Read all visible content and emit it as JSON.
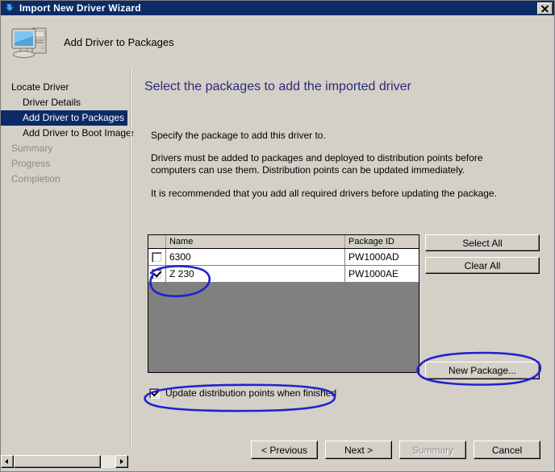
{
  "window": {
    "title": "Import New Driver Wizard",
    "title_icon": "blue-arrow-icon",
    "close_label": "×",
    "header_title": "Add Driver to Packages",
    "header_icon": "computer-icon"
  },
  "sidebar": {
    "items": [
      {
        "label": "Locate Driver",
        "indent": false,
        "state": "done"
      },
      {
        "label": "Driver Details",
        "indent": true,
        "state": "done"
      },
      {
        "label": "Add Driver to Packages",
        "indent": true,
        "state": "selected"
      },
      {
        "label": "Add Driver to Boot Images",
        "indent": true,
        "state": "done"
      },
      {
        "label": "Summary",
        "indent": false,
        "state": "disabled"
      },
      {
        "label": "Progress",
        "indent": false,
        "state": "disabled"
      },
      {
        "label": "Completion",
        "indent": false,
        "state": "disabled"
      }
    ]
  },
  "content": {
    "heading": "Select the packages to add the imported driver",
    "paragraphs": [
      "Specify the package to add this driver to.",
      "Drivers must be added to packages and deployed to distribution points before computers can use them.  Distribution points can be updated immediately.",
      "It is recommended that you add all required drivers before updating the package."
    ]
  },
  "package_list": {
    "columns": [
      "",
      "Name",
      "Package ID"
    ],
    "rows": [
      {
        "checked": false,
        "name": "6300",
        "package_id": "PW1000AD"
      },
      {
        "checked": true,
        "name": "Z 230",
        "package_id": "PW1000AE"
      }
    ]
  },
  "buttons": {
    "select_all": "Select All",
    "clear_all": "Clear All",
    "new_package": "New Package...",
    "previous": "< Previous",
    "next": "Next >",
    "summary": "Summary",
    "cancel": "Cancel"
  },
  "options": {
    "update_distribution": {
      "label": "Update distribution points when finished",
      "checked": true
    }
  },
  "colors": {
    "titlebar": "#0b2a66",
    "face": "#d4d0c8",
    "heading": "#2a2a7a",
    "selection": "#0b2a66",
    "list_empty": "#808080",
    "ink": "#2222cc"
  }
}
